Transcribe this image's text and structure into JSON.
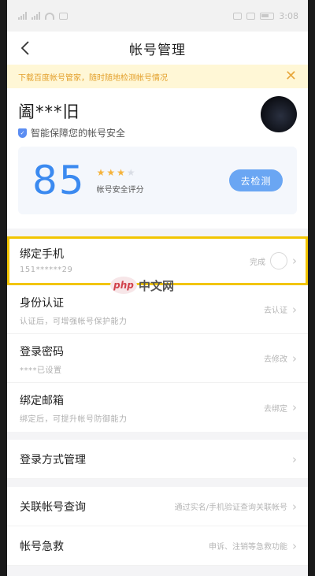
{
  "statusbar": {
    "time": "3:08"
  },
  "nav": {
    "title": "帐号管理"
  },
  "banner": {
    "text": "下载百度帐号管家，随时随地检测帐号情况",
    "close": "✕"
  },
  "profile": {
    "username": "阖***旧",
    "tagline": "智能保障您的帐号安全"
  },
  "score": {
    "value": "85",
    "stars_filled": 3,
    "stars_total": 4,
    "label": "帐号安全评分",
    "button": "去检测"
  },
  "security_items": [
    {
      "title": "绑定手机",
      "sub": "151******29",
      "action": "完成"
    },
    {
      "title": "身份认证",
      "sub": "认证后，可增强帐号保护能力",
      "action": "去认证"
    },
    {
      "title": "登录密码",
      "sub": "****已设置",
      "action": "去修改"
    },
    {
      "title": "绑定邮箱",
      "sub": "绑定后，可提升帐号防御能力",
      "action": "去绑定"
    }
  ],
  "login_manage": {
    "title": "登录方式管理"
  },
  "linked_query": {
    "title": "关联帐号查询",
    "hint": "通过实名/手机验证查询关联帐号"
  },
  "rescue": {
    "title": "帐号急救",
    "hint": "申诉、注销等急救功能"
  },
  "watermark": {
    "logo": "php",
    "text": "中文网"
  },
  "colors": {
    "accent": "#3b8af0",
    "banner_bg": "#fff7d6",
    "banner_text": "#e3a02c",
    "highlight": "#f2c500"
  }
}
